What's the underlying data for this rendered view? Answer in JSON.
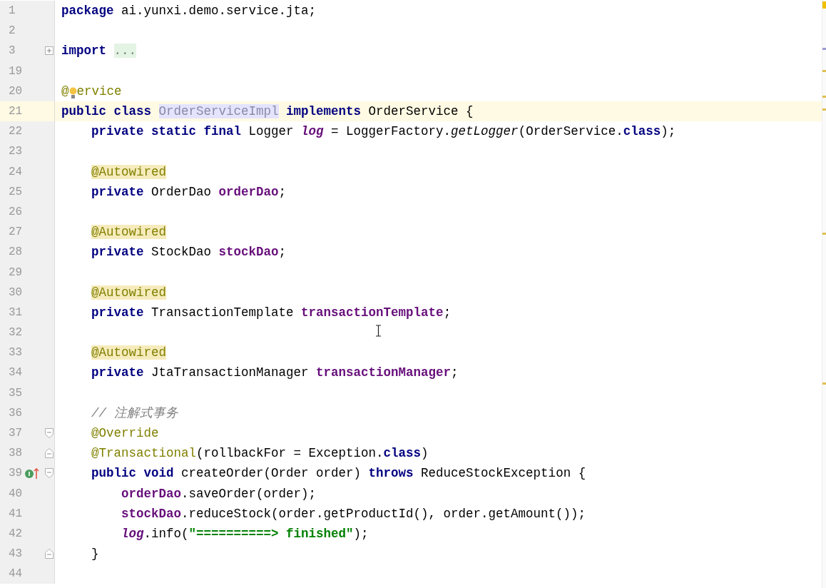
{
  "editor": {
    "lines": [
      {
        "number": "1",
        "current": false,
        "tokens": [
          {
            "kind": "keyword",
            "text": "package"
          },
          {
            "kind": "plain",
            "text": " ai.yunxi.demo.service.jta;"
          }
        ]
      },
      {
        "number": "2",
        "current": false
      },
      {
        "number": "3",
        "current": false,
        "fold": {
          "kind": "expand"
        },
        "tokens": [
          {
            "kind": "keyword",
            "text": "import "
          },
          {
            "kind": "folded",
            "text": "..."
          }
        ]
      },
      {
        "number": "19",
        "current": false
      },
      {
        "number": "20",
        "current": false,
        "bulb": true,
        "tokens": [
          {
            "kind": "annotation",
            "text": "@"
          },
          {
            "kind": "annotation",
            "text": "ervice"
          }
        ]
      },
      {
        "number": "21",
        "current": true,
        "tokens": [
          {
            "kind": "keyword",
            "text": "public class "
          },
          {
            "kind": "usage",
            "text": "OrderServiceImpl"
          },
          {
            "kind": "keyword",
            "text": " implements"
          },
          {
            "kind": "plain",
            "text": " OrderService {"
          }
        ]
      },
      {
        "number": "22",
        "current": false,
        "tokens": [
          {
            "kind": "keyword",
            "text": "    private static final"
          },
          {
            "kind": "plain",
            "text": " Logger "
          },
          {
            "kind": "static",
            "text": "log"
          },
          {
            "kind": "plain",
            "text": " = LoggerFactory."
          },
          {
            "kind": "static_call",
            "text": "getLogger"
          },
          {
            "kind": "plain",
            "text": "(OrderService."
          },
          {
            "kind": "keyword",
            "text": "class"
          },
          {
            "kind": "plain",
            "text": ");"
          }
        ]
      },
      {
        "number": "23",
        "current": false
      },
      {
        "number": "24",
        "current": false,
        "tokens": [
          {
            "kind": "annotation_hl",
            "text": "    @Autowired"
          }
        ]
      },
      {
        "number": "25",
        "current": false,
        "tokens": [
          {
            "kind": "keyword",
            "text": "    private"
          },
          {
            "kind": "plain",
            "text": " OrderDao "
          },
          {
            "kind": "field",
            "text": "orderDao"
          },
          {
            "kind": "plain",
            "text": ";"
          }
        ]
      },
      {
        "number": "26",
        "current": false
      },
      {
        "number": "27",
        "current": false,
        "tokens": [
          {
            "kind": "annotation_hl",
            "text": "    @Autowired"
          }
        ]
      },
      {
        "number": "28",
        "current": false,
        "tokens": [
          {
            "kind": "keyword",
            "text": "    private"
          },
          {
            "kind": "plain",
            "text": " StockDao "
          },
          {
            "kind": "field",
            "text": "stockDao"
          },
          {
            "kind": "plain",
            "text": ";"
          }
        ]
      },
      {
        "number": "29",
        "current": false
      },
      {
        "number": "30",
        "current": false,
        "tokens": [
          {
            "kind": "annotation_hl",
            "text": "    @Autowired"
          }
        ]
      },
      {
        "number": "31",
        "current": false,
        "tokens": [
          {
            "kind": "keyword",
            "text": "    private"
          },
          {
            "kind": "plain",
            "text": " TransactionTemplate "
          },
          {
            "kind": "field",
            "text": "transactionTemplate"
          },
          {
            "kind": "plain",
            "text": ";"
          }
        ]
      },
      {
        "number": "32",
        "current": false
      },
      {
        "number": "33",
        "current": false,
        "tokens": [
          {
            "kind": "annotation_hl",
            "text": "    @Autowired"
          }
        ]
      },
      {
        "number": "34",
        "current": false,
        "tokens": [
          {
            "kind": "keyword",
            "text": "    private"
          },
          {
            "kind": "plain",
            "text": " JtaTransactionManager "
          },
          {
            "kind": "field",
            "text": "transactionManager"
          },
          {
            "kind": "plain",
            "text": ";"
          }
        ]
      },
      {
        "number": "35",
        "current": false
      },
      {
        "number": "36",
        "current": false,
        "tokens": [
          {
            "kind": "comment",
            "text": "    // 注解式事务"
          }
        ]
      },
      {
        "number": "37",
        "current": false,
        "fold": {
          "kind": "start"
        },
        "tokens": [
          {
            "kind": "annotation",
            "text": "    @Override"
          }
        ]
      },
      {
        "number": "38",
        "current": false,
        "fold": {
          "kind": "end"
        },
        "tokens": [
          {
            "kind": "annotation",
            "text": "    @Transactional"
          },
          {
            "kind": "plain",
            "text": "(rollbackFor = Exception."
          },
          {
            "kind": "keyword",
            "text": "class"
          },
          {
            "kind": "plain",
            "text": ")"
          }
        ]
      },
      {
        "number": "39",
        "current": false,
        "fold": {
          "kind": "start"
        },
        "implements": true,
        "tokens": [
          {
            "kind": "keyword",
            "text": "    public void"
          },
          {
            "kind": "plain",
            "text": " createOrder(Order order) "
          },
          {
            "kind": "keyword",
            "text": "throws"
          },
          {
            "kind": "plain",
            "text": " ReduceStockException {"
          }
        ]
      },
      {
        "number": "40",
        "current": false,
        "tokens": [
          {
            "kind": "field",
            "text": "        orderDao"
          },
          {
            "kind": "plain",
            "text": ".saveOrder(order);"
          }
        ]
      },
      {
        "number": "41",
        "current": false,
        "tokens": [
          {
            "kind": "field",
            "text": "        stockDao"
          },
          {
            "kind": "plain",
            "text": ".reduceStock(order.getProductId(), order.getAmount());"
          }
        ]
      },
      {
        "number": "42",
        "current": false,
        "tokens": [
          {
            "kind": "static",
            "text": "        log"
          },
          {
            "kind": "plain",
            "text": ".info("
          },
          {
            "kind": "string",
            "text": "\"==========> finished\""
          },
          {
            "kind": "plain",
            "text": ");"
          }
        ]
      },
      {
        "number": "43",
        "current": false,
        "fold": {
          "kind": "end"
        },
        "tokens": [
          {
            "kind": "plain",
            "text": "    }"
          }
        ]
      },
      {
        "number": "44",
        "current": false
      }
    ]
  }
}
